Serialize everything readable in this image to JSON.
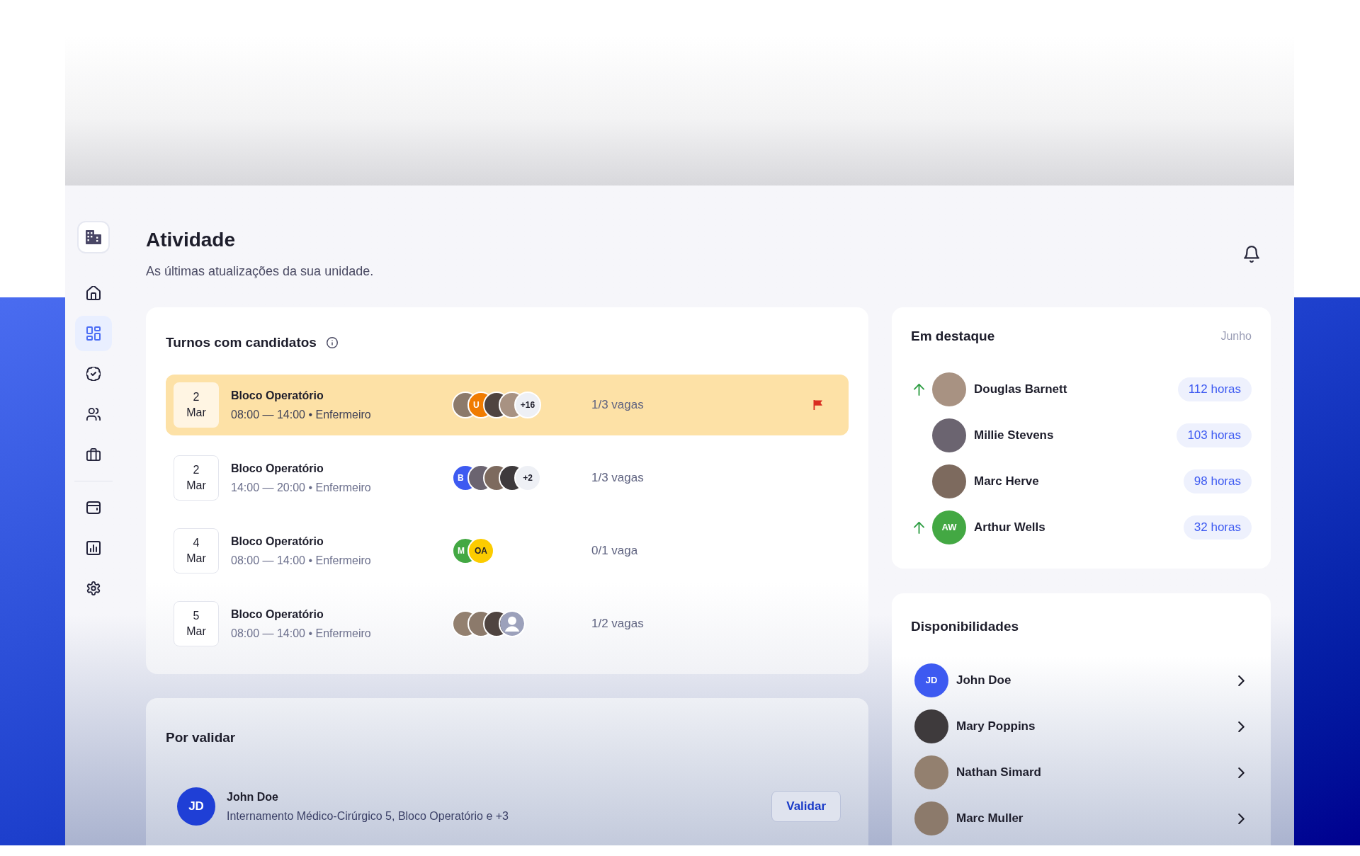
{
  "sidebar": {
    "primary": [
      {
        "kind": "home",
        "selected": false
      },
      {
        "kind": "dashboard",
        "selected": true
      },
      {
        "kind": "badge",
        "selected": false
      },
      {
        "kind": "users",
        "selected": false
      },
      {
        "kind": "briefcase",
        "selected": false
      }
    ],
    "secondary": [
      {
        "kind": "wallet",
        "selected": false
      },
      {
        "kind": "chart",
        "selected": false
      },
      {
        "kind": "settings",
        "selected": false
      }
    ]
  },
  "header": {
    "title": "Atividade",
    "subtitle": "As últimas atualizações da sua unidade."
  },
  "shifts": {
    "title": "Turnos com candidatos",
    "rows": [
      {
        "day": "2",
        "month": "Mar",
        "unit": "Bloco Operatório",
        "details": "08:00 — 14:00 • Enfermeiro",
        "candidates": [
          {
            "kind": "photo"
          },
          {
            "kind": "initials",
            "text": "U",
            "color": "#f07c00"
          },
          {
            "kind": "photo"
          },
          {
            "kind": "photo"
          },
          {
            "kind": "more",
            "text": "+16"
          }
        ],
        "slots": "1/3 vagas",
        "flagged": true
      },
      {
        "day": "2",
        "month": "Mar",
        "unit": "Bloco Operatório",
        "details": "14:00 — 20:00 • Enfermeiro",
        "candidates": [
          {
            "kind": "initials",
            "text": "B",
            "color": "#3d5af1"
          },
          {
            "kind": "photo"
          },
          {
            "kind": "photo"
          },
          {
            "kind": "photo"
          },
          {
            "kind": "more",
            "text": "+2"
          }
        ],
        "slots": "1/3 vagas",
        "flagged": false
      },
      {
        "day": "4",
        "month": "Mar",
        "unit": "Bloco Operatório",
        "details": "08:00 — 14:00 • Enfermeiro",
        "candidates": [
          {
            "kind": "initials",
            "text": "M",
            "color": "#43a843"
          },
          {
            "kind": "initials",
            "text": "OA",
            "color": "#fccc00"
          }
        ],
        "slots": "0/1 vaga",
        "flagged": false
      },
      {
        "day": "5",
        "month": "Mar",
        "unit": "Bloco Operatório",
        "details": "08:00 — 14:00 • Enfermeiro",
        "candidates": [
          {
            "kind": "photo"
          },
          {
            "kind": "photo"
          },
          {
            "kind": "photo"
          },
          {
            "kind": "placeholder"
          }
        ],
        "slots": "1/2 vagas",
        "flagged": false
      }
    ]
  },
  "featured": {
    "title": "Em destaque",
    "period": "Junho",
    "people": [
      {
        "rising": true,
        "avatar": {
          "kind": "photo"
        },
        "name": "Douglas Barnett",
        "hours": "112 horas"
      },
      {
        "rising": false,
        "avatar": {
          "kind": "photo"
        },
        "name": "Millie Stevens",
        "hours": "103 horas"
      },
      {
        "rising": false,
        "avatar": {
          "kind": "photo"
        },
        "name": "Marc Herve",
        "hours": "98 horas"
      },
      {
        "rising": true,
        "avatar": {
          "kind": "initials",
          "text": "AW",
          "color": "#43a843"
        },
        "name": "Arthur Wells",
        "hours": "32 horas"
      }
    ]
  },
  "pending": {
    "title": "Por validar",
    "items": [
      {
        "avatar": {
          "kind": "initials",
          "text": "JD",
          "color": "#1f3fd6"
        },
        "name": "John Doe",
        "details": "Internamento Médico-Cirúrgico 5, Bloco Operatório e +3",
        "action": "Validar"
      }
    ]
  },
  "availability": {
    "title": "Disponibilidades",
    "people": [
      {
        "avatar": {
          "kind": "initials",
          "text": "JD",
          "color": "#3d5af1"
        },
        "name": "John Doe"
      },
      {
        "avatar": {
          "kind": "photo"
        },
        "name": "Mary Poppins"
      },
      {
        "avatar": {
          "kind": "photo"
        },
        "name": "Nathan Simard"
      },
      {
        "avatar": {
          "kind": "photo"
        },
        "name": "Marc Muller"
      }
    ]
  }
}
